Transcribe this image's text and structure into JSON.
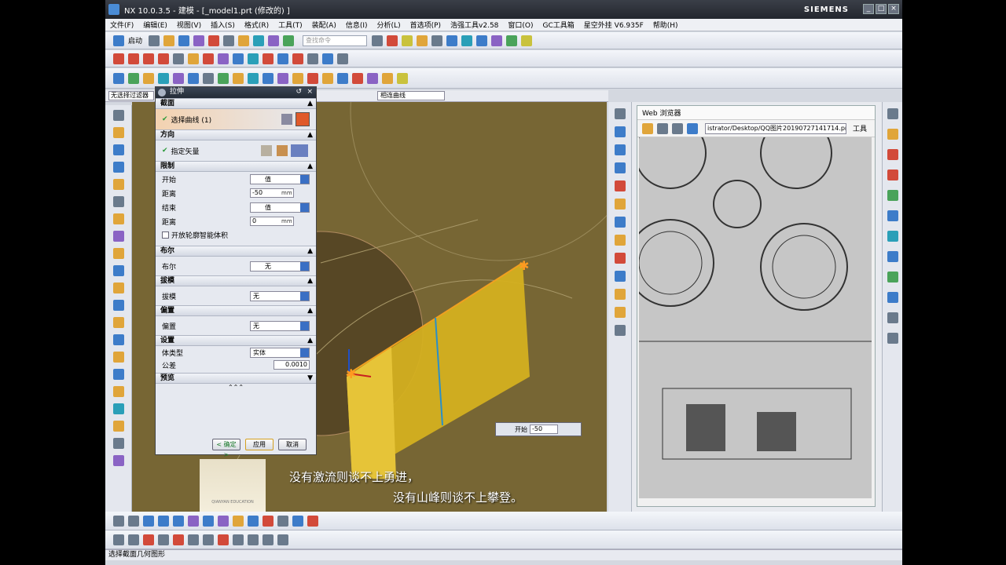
{
  "window": {
    "title": "NX 10.0.3.5 - 建模 - [_model1.prt  (修改的) ]",
    "brand": "SIEMENS"
  },
  "menu": [
    "文件(F)",
    "编辑(E)",
    "视图(V)",
    "插入(S)",
    "格式(R)",
    "工具(T)",
    "装配(A)",
    "信息(I)",
    "分析(L)",
    "首选项(P)",
    "浩强工具v2.58",
    "窗口(O)",
    "GC工具箱",
    "星空外挂 V6.935F",
    "帮助(H)"
  ],
  "toolbar": {
    "start_label": "启动",
    "search_placeholder": "查找命令"
  },
  "filter": {
    "value": "无选择过滤器",
    "curve_rule": "相连曲线"
  },
  "dialog": {
    "title": "拉伸",
    "section": {
      "header": "截面",
      "select_curve": "选择曲线 (1)"
    },
    "direction": {
      "header": "方向",
      "vector": "指定矢量"
    },
    "limits": {
      "header": "限制",
      "start_label": "开始",
      "start_type": "值",
      "distance_label": "距离",
      "start_distance": "-50",
      "end_label": "结束",
      "end_type": "值",
      "end_distance": "0",
      "unit": "mm",
      "open_profile": "开放轮廓智能体积"
    },
    "boolean": {
      "header": "布尔",
      "label": "布尔",
      "value": "无"
    },
    "draft": {
      "header": "拔模",
      "label": "拔模",
      "value": "无"
    },
    "offset": {
      "header": "偏置",
      "label": "偏置",
      "value": "无"
    },
    "settings": {
      "header": "设置",
      "body_type_label": "体类型",
      "body_type": "实体",
      "tolerance_label": "公差",
      "tolerance": "0.0010"
    },
    "preview": {
      "header": "预览"
    },
    "ok": "< 确定 >",
    "apply": "应用",
    "cancel": "取消"
  },
  "onscreen": {
    "label": "开始",
    "value": "-50"
  },
  "web": {
    "title": "Web 浏览器",
    "address": "istrator/Desktop/QQ图片20190727141714.png",
    "tools": "工具"
  },
  "captions": [
    "没有激流则谈不上勇进，",
    "没有山峰则谈不上攀登。"
  ],
  "status": "选择截面几何图形",
  "watermark": "QIANYAN EDUCATION"
}
